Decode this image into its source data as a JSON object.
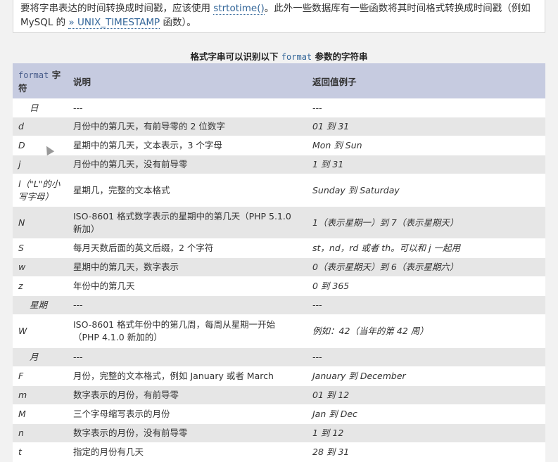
{
  "intro": {
    "line1_pre": "要将字串表达的时间转换成时间戳，应该使用 ",
    "strtotime_link": "strtotime()",
    "line1_post": "。此外一些数据库有一些函数将其时间格式转换成时间戳（例如",
    "line2_pre": "MySQL 的 ",
    "unix_link": "» UNIX_TIMESTAMP",
    "line2_post": " 函数）。"
  },
  "caption": {
    "pre": "格式字串可以识别以下 ",
    "code": "format",
    "post": " 参数的字符串"
  },
  "header": {
    "col1_code": "format",
    "col1_text": " 字符",
    "col2": "说明",
    "col3": "返回值例子"
  },
  "rows": [
    {
      "fmt": "日",
      "desc": "---",
      "ex": "---",
      "section": true,
      "h": 26
    },
    {
      "fmt": "d",
      "desc": "月份中的第几天，有前导零的 2 位数字",
      "ex": "01 到 31",
      "h": 27
    },
    {
      "fmt": "D",
      "desc": "星期中的第几天，文本表示，3 个字母",
      "ex": "Mon 到 Sun",
      "h": 27
    },
    {
      "fmt": "j",
      "desc": "月份中的第几天，没有前导零",
      "ex": "1 到 31",
      "h": 27
    },
    {
      "fmt": "l（\"L\"的小写字母）",
      "desc": "星期几，完整的文本格式",
      "ex": "Sunday 到 Saturday",
      "h": 46
    },
    {
      "fmt": "N",
      "desc": "ISO-8601 格式数字表示的星期中的第几天（PHP 5.1.0 新加）",
      "ex": "1（表示星期一）到 7（表示星期天）",
      "h": 46
    },
    {
      "fmt": "S",
      "desc": "每月天数后面的英文后缀，2 个字符",
      "ex": "st，nd，rd 或者 th。可以和 j 一起用",
      "h": 27
    },
    {
      "fmt": "w",
      "desc": "星期中的第几天，数字表示",
      "ex": "0（表示星期天）到 6（表示星期六）",
      "h": 27
    },
    {
      "fmt": "z",
      "desc": "年份中的第几天",
      "ex": "0 到 365",
      "h": 27
    },
    {
      "fmt": "星期",
      "desc": "---",
      "ex": "---",
      "section": true,
      "h": 27
    },
    {
      "fmt": "W",
      "desc": "ISO-8601 格式年份中的第几周，每周从星期一开始（PHP 4.1.0 新加的）",
      "ex": "例如：42（当年的第 42 周）",
      "h": 47
    },
    {
      "fmt": "月",
      "desc": "---",
      "ex": "---",
      "section": true,
      "h": 27
    },
    {
      "fmt": "F",
      "desc": "月份，完整的文本格式，例如 January 或者 March",
      "ex": "January 到 December",
      "h": 27
    },
    {
      "fmt": "m",
      "desc": "数字表示的月份，有前导零",
      "ex": "01 到 12",
      "h": 27
    },
    {
      "fmt": "M",
      "desc": "三个字母缩写表示的月份",
      "ex": "Jan 到 Dec",
      "h": 27
    },
    {
      "fmt": "n",
      "desc": "数字表示的月份，没有前导零",
      "ex": "1 到 12",
      "h": 27
    },
    {
      "fmt": "t",
      "desc": "指定的月份有几天",
      "ex": "28 到 31",
      "h": 27
    }
  ]
}
